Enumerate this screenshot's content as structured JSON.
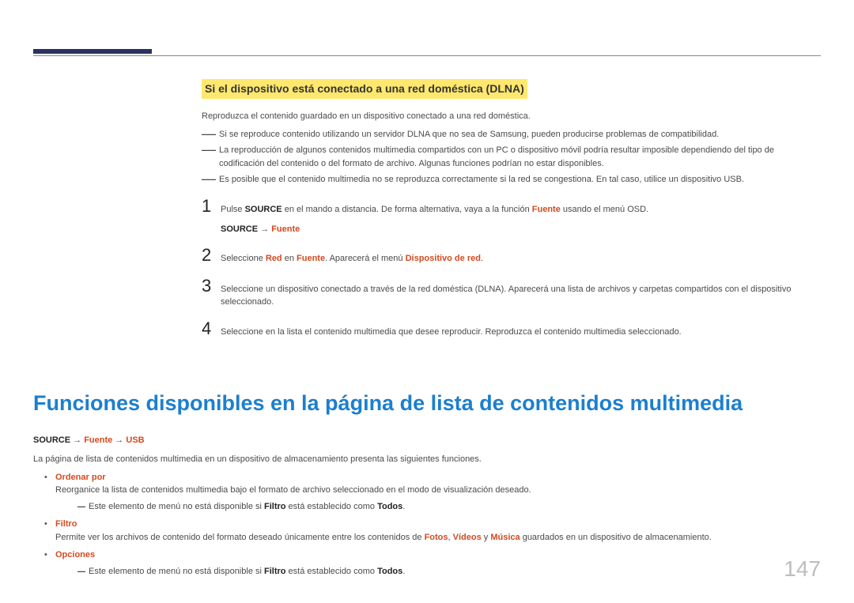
{
  "section": {
    "title": "Si el dispositivo está conectado a una red doméstica (DLNA)",
    "intro": "Reproduzca el contenido guardado en un dispositivo conectado a una red doméstica.",
    "notes": [
      "Si se reproduce contenido utilizando un servidor DLNA que no sea de Samsung, pueden producirse problemas de compatibilidad.",
      "La reproducción de algunos contenidos multimedia compartidos con un PC o dispositivo móvil podría resultar imposible dependiendo del tipo de codificación del contenido o del formato de archivo. Algunas funciones podrían no estar disponibles.",
      "Es posible que el contenido multimedia no se reproduzca correctamente si la red se congestiona. En tal caso, utilice un dispositivo USB."
    ],
    "steps": {
      "n1": "1",
      "s1_pre": "Pulse ",
      "s1_source": "SOURCE",
      "s1_mid": " en el mando a distancia. De forma alternativa, vaya a la función ",
      "s1_fuente": "Fuente",
      "s1_post": " usando el menú OSD.",
      "path_source": "SOURCE",
      "path_arrow": " → ",
      "path_fuente": "Fuente",
      "n2": "2",
      "s2_pre": "Seleccione ",
      "s2_red": "Red",
      "s2_mid1": " en ",
      "s2_fuente": "Fuente",
      "s2_mid2": ". Aparecerá el menú ",
      "s2_disp": "Dispositivo de red",
      "s2_post": ".",
      "n3": "3",
      "s3": "Seleccione un dispositivo conectado a través de la red doméstica (DLNA). Aparecerá una lista de archivos y carpetas compartidos con el dispositivo seleccionado.",
      "n4": "4",
      "s4": "Seleccione en la lista el contenido multimedia que desee reproducir. Reproduzca el contenido multimedia seleccionado."
    }
  },
  "major": {
    "title": "Funciones disponibles en la página de lista de contenidos multimedia",
    "path_source": "SOURCE",
    "path_arrow1": " → ",
    "path_fuente": "Fuente",
    "path_arrow2": " → ",
    "path_usb": "USB",
    "intro": "La página de lista de contenidos multimedia en un dispositivo de almacenamiento presenta las siguientes funciones.",
    "items": {
      "ordenar": {
        "label": "Ordenar por",
        "desc": "Reorganice la lista de contenidos multimedia bajo el formato de archivo seleccionado en el modo de visualización deseado.",
        "sub_pre": "Este elemento de menú no está disponible si ",
        "sub_filtro": "Filtro",
        "sub_mid": " está establecido como ",
        "sub_todos": "Todos",
        "sub_post": "."
      },
      "filtro": {
        "label": "Filtro",
        "desc_pre": "Permite ver los archivos de contenido del formato deseado únicamente entre los contenidos de ",
        "fotos": "Fotos",
        "sep1": ", ",
        "videos": "Vídeos",
        "sep2": " y ",
        "musica": "Música",
        "desc_post": " guardados en un dispositivo de almacenamiento."
      },
      "opciones": {
        "label": "Opciones",
        "sub_pre": "Este elemento de menú no está disponible si ",
        "sub_filtro": "Filtro",
        "sub_mid": " está establecido como ",
        "sub_todos": "Todos",
        "sub_post": "."
      }
    }
  },
  "page_number": "147"
}
